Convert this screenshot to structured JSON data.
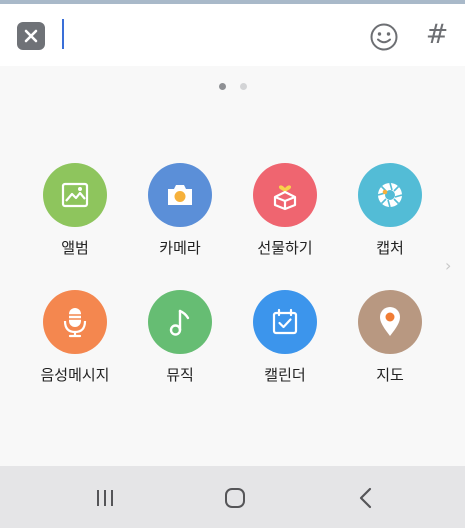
{
  "input": {
    "value": "",
    "hash_label": "#"
  },
  "pager": {
    "pages": 2,
    "current": 1
  },
  "grid": {
    "items": [
      {
        "label": "앨범",
        "color": "#8ec55d",
        "icon": "photo-icon"
      },
      {
        "label": "카메라",
        "color": "#5b8fd8",
        "icon": "camera-icon"
      },
      {
        "label": "선물하기",
        "color": "#ef6570",
        "icon": "gift-icon"
      },
      {
        "label": "캡처",
        "color": "#53bcd6",
        "icon": "aperture-icon"
      },
      {
        "label": "음성메시지",
        "color": "#f4874f",
        "icon": "microphone-icon"
      },
      {
        "label": "뮤직",
        "color": "#66bd73",
        "icon": "music-note-icon"
      },
      {
        "label": "캘린더",
        "color": "#3c95ec",
        "icon": "calendar-icon"
      },
      {
        "label": "지도",
        "color": "#b89881",
        "icon": "map-pin-icon"
      }
    ]
  },
  "more_indicator": "›"
}
